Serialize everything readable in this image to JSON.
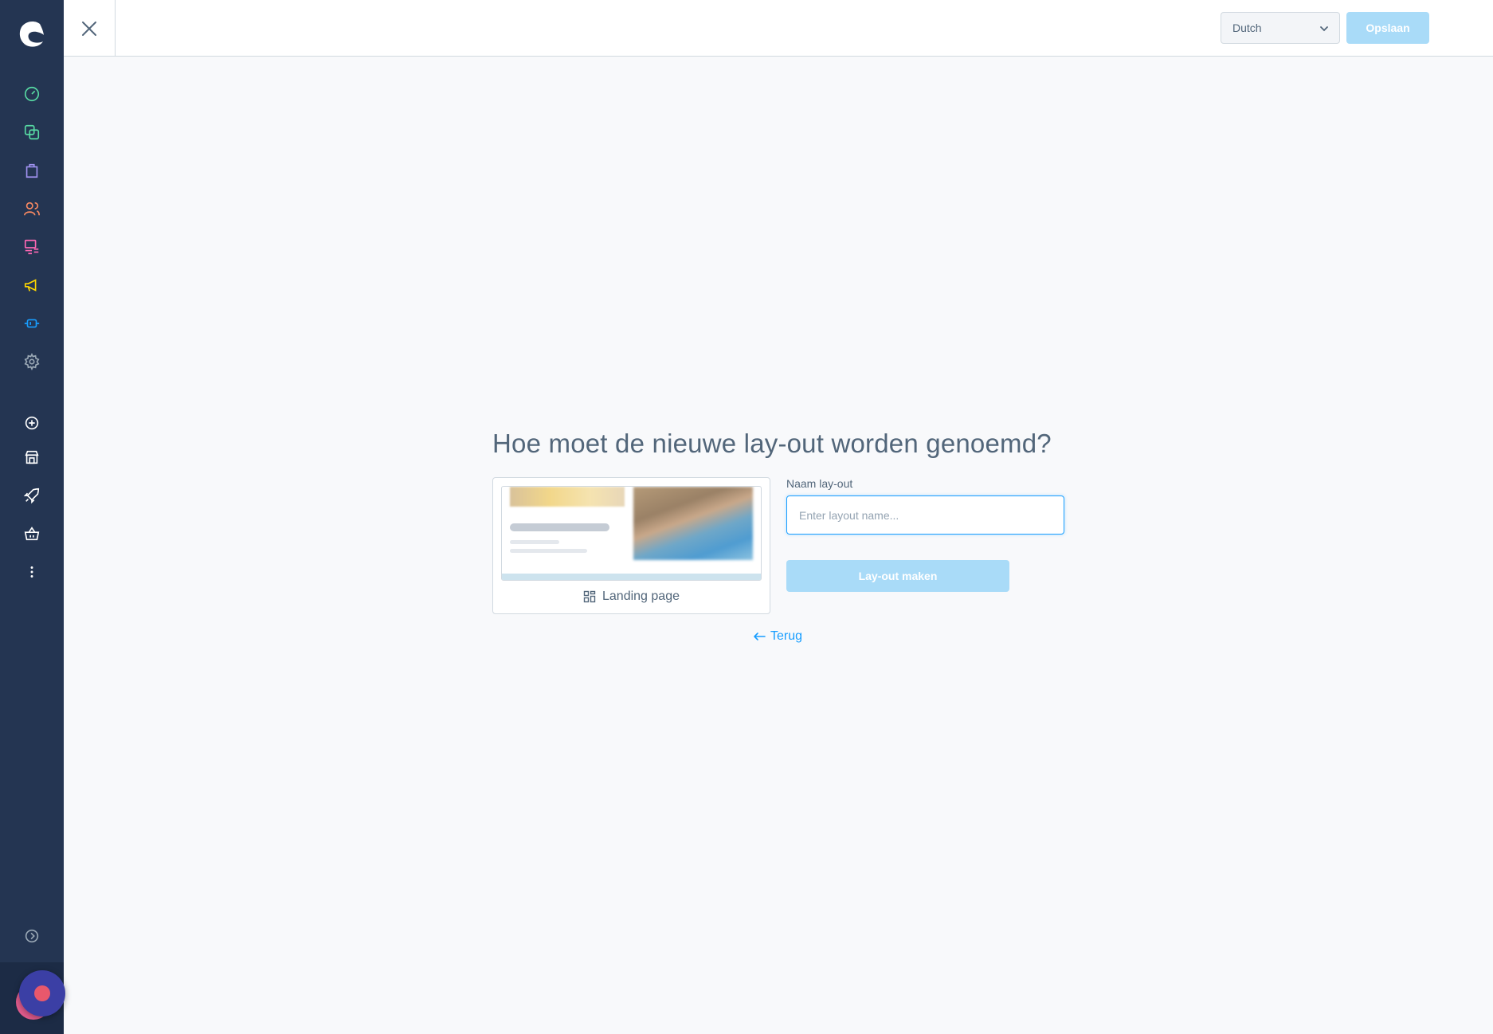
{
  "topbar": {
    "language": "Dutch",
    "save_label": "Opslaan"
  },
  "sidebar": {
    "items": [
      {
        "icon": "dashboard-icon",
        "color": "#57d9a3"
      },
      {
        "icon": "catalog-icon",
        "color": "#57d9a3"
      },
      {
        "icon": "orders-icon",
        "color": "#a092f0"
      },
      {
        "icon": "customers-icon",
        "color": "#f88962"
      },
      {
        "icon": "content-icon",
        "color": "#ff68b4"
      },
      {
        "icon": "marketing-icon",
        "color": "#ffd700"
      },
      {
        "icon": "extensions-icon",
        "color": "#189eff"
      },
      {
        "icon": "settings-icon",
        "color": "#9aa8b5"
      },
      {
        "icon": "add-icon",
        "color": "#ffffff"
      },
      {
        "icon": "sales-channel-icon",
        "color": "#ffffff"
      },
      {
        "icon": "rocket-icon",
        "color": "#ffffff"
      },
      {
        "icon": "basket-icon",
        "color": "#ffffff"
      },
      {
        "icon": "more-icon",
        "color": "#ffffff"
      },
      {
        "icon": "expand-icon",
        "color": "#9aa8b5"
      }
    ]
  },
  "main": {
    "heading": "Hoe moet de nieuwe lay-out worden genoemd?",
    "card_label": "Landing page",
    "field_label": "Naam lay-out",
    "input_placeholder": "Enter layout name...",
    "input_value": "",
    "make_button": "Lay-out maken",
    "back_link": "Terug"
  },
  "colors": {
    "sidebar_bg": "#243552",
    "accent": "#189eff",
    "button_disabled": "#a9dbf8",
    "text": "#52667a"
  }
}
